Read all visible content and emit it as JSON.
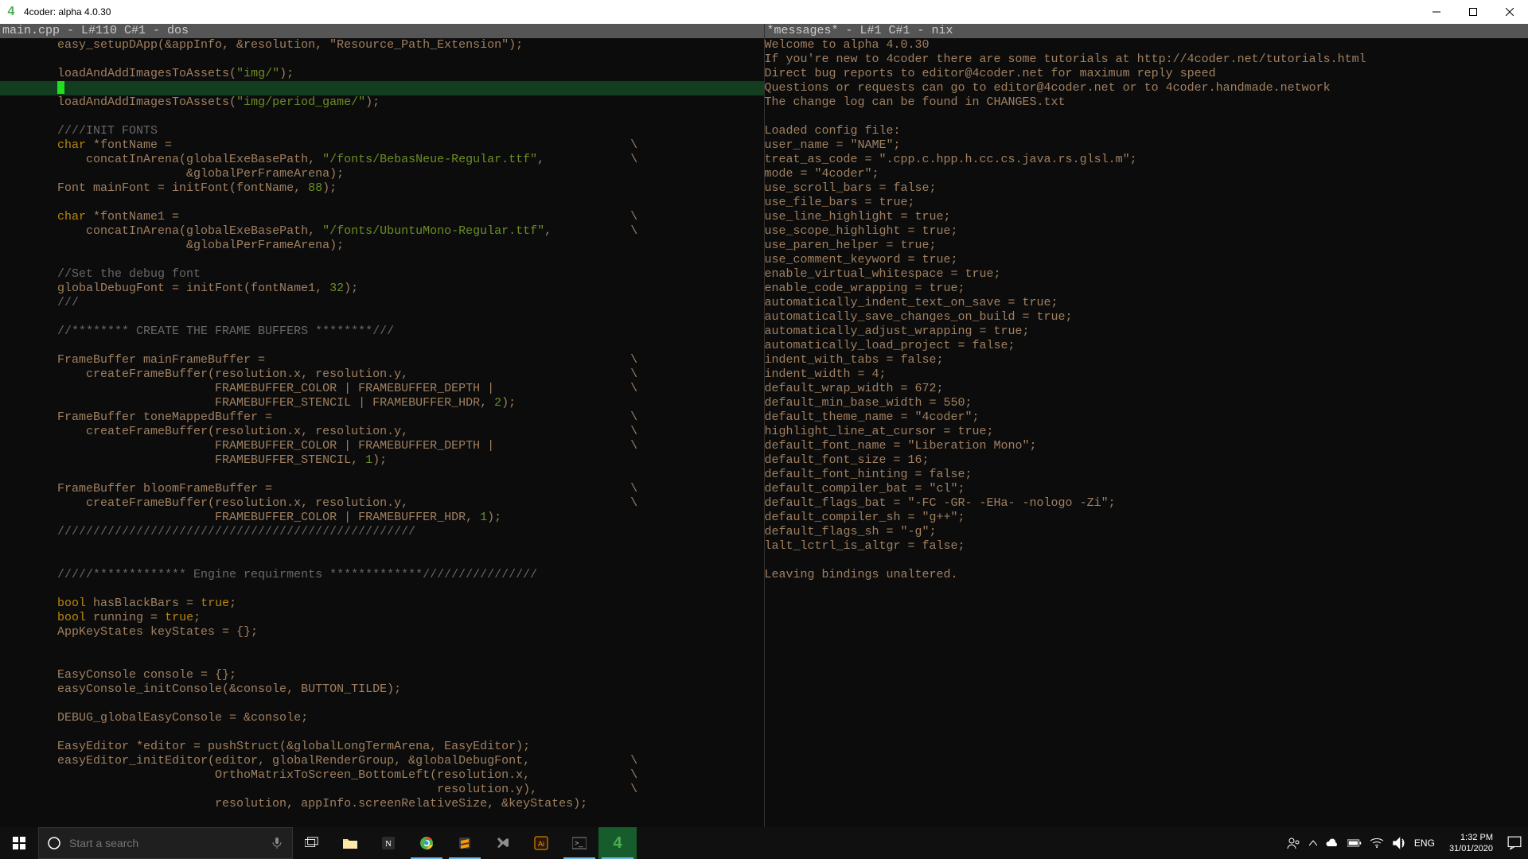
{
  "window": {
    "title": "4coder: alpha 4.0.30",
    "app_icon_char": "4"
  },
  "left_pane": {
    "header": "main.cpp - L#110 C#1 - dos",
    "lines": [
      {
        "indent": 8,
        "segs": [
          [
            "default",
            "easy_setupDApp(&appInfo, &resolution, \"Resource_Path_Extension\");"
          ]
        ]
      },
      {
        "indent": 0,
        "segs": []
      },
      {
        "indent": 8,
        "segs": [
          [
            "default",
            "loadAndAddImagesToAssets("
          ],
          [
            "str",
            "\"img/\""
          ],
          [
            "default",
            ");"
          ]
        ]
      },
      {
        "cursor": true,
        "indent": 8,
        "segs": []
      },
      {
        "indent": 8,
        "segs": [
          [
            "default",
            "loadAndAddImagesToAssets("
          ],
          [
            "str",
            "\"img/period_game/\""
          ],
          [
            "default",
            ");"
          ]
        ]
      },
      {
        "indent": 0,
        "segs": []
      },
      {
        "indent": 8,
        "segs": [
          [
            "comment",
            "////INIT FONTS"
          ]
        ]
      },
      {
        "indent": 8,
        "segs": [
          [
            "kw",
            "char"
          ],
          [
            "default",
            " *fontName ="
          ]
        ],
        "cont": true
      },
      {
        "indent": 12,
        "segs": [
          [
            "default",
            "concatInArena(globalExeBasePath, "
          ],
          [
            "str",
            "\"/fonts/BebasNeue-Regular.ttf\""
          ],
          [
            "default",
            ","
          ]
        ],
        "cont": true
      },
      {
        "indent": 26,
        "segs": [
          [
            "default",
            "&globalPerFrameArena);"
          ]
        ]
      },
      {
        "indent": 8,
        "segs": [
          [
            "default",
            "Font mainFont = initFont(fontName, "
          ],
          [
            "num",
            "88"
          ],
          [
            "default",
            ");"
          ]
        ]
      },
      {
        "indent": 0,
        "segs": []
      },
      {
        "indent": 8,
        "segs": [
          [
            "kw",
            "char"
          ],
          [
            "default",
            " *fontName1 ="
          ]
        ],
        "cont": true
      },
      {
        "indent": 12,
        "segs": [
          [
            "default",
            "concatInArena(globalExeBasePath, "
          ],
          [
            "str",
            "\"/fonts/UbuntuMono-Regular.ttf\""
          ],
          [
            "default",
            ","
          ]
        ],
        "cont": true
      },
      {
        "indent": 26,
        "segs": [
          [
            "default",
            "&globalPerFrameArena);"
          ]
        ]
      },
      {
        "indent": 0,
        "segs": []
      },
      {
        "indent": 8,
        "segs": [
          [
            "comment",
            "//Set the debug font"
          ]
        ]
      },
      {
        "indent": 8,
        "segs": [
          [
            "default",
            "globalDebugFont = initFont(fontName1, "
          ],
          [
            "num",
            "32"
          ],
          [
            "default",
            ");"
          ]
        ]
      },
      {
        "indent": 8,
        "segs": [
          [
            "comment",
            "///"
          ]
        ]
      },
      {
        "indent": 0,
        "segs": []
      },
      {
        "indent": 8,
        "segs": [
          [
            "comment",
            "//******** CREATE THE FRAME BUFFERS ********///"
          ]
        ]
      },
      {
        "indent": 0,
        "segs": []
      },
      {
        "indent": 8,
        "segs": [
          [
            "default",
            "FrameBuffer mainFrameBuffer ="
          ]
        ],
        "cont": true
      },
      {
        "indent": 12,
        "segs": [
          [
            "default",
            "createFrameBuffer(resolution.x, resolution.y,"
          ]
        ],
        "cont": true
      },
      {
        "indent": 30,
        "segs": [
          [
            "default",
            "FRAMEBUFFER_COLOR | FRAMEBUFFER_DEPTH |"
          ]
        ],
        "cont": true
      },
      {
        "indent": 30,
        "segs": [
          [
            "default",
            "FRAMEBUFFER_STENCIL | FRAMEBUFFER_HDR, "
          ],
          [
            "num",
            "2"
          ],
          [
            "default",
            ");"
          ]
        ]
      },
      {
        "indent": 8,
        "segs": [
          [
            "default",
            "FrameBuffer toneMappedBuffer ="
          ]
        ],
        "cont": true
      },
      {
        "indent": 12,
        "segs": [
          [
            "default",
            "createFrameBuffer(resolution.x, resolution.y,"
          ]
        ],
        "cont": true
      },
      {
        "indent": 30,
        "segs": [
          [
            "default",
            "FRAMEBUFFER_COLOR | FRAMEBUFFER_DEPTH |"
          ]
        ],
        "cont": true
      },
      {
        "indent": 30,
        "segs": [
          [
            "default",
            "FRAMEBUFFER_STENCIL, "
          ],
          [
            "num",
            "1"
          ],
          [
            "default",
            ");"
          ]
        ]
      },
      {
        "indent": 0,
        "segs": []
      },
      {
        "indent": 8,
        "segs": [
          [
            "default",
            "FrameBuffer bloomFrameBuffer ="
          ]
        ],
        "cont": true
      },
      {
        "indent": 12,
        "segs": [
          [
            "default",
            "createFrameBuffer(resolution.x, resolution.y,"
          ]
        ],
        "cont": true
      },
      {
        "indent": 30,
        "segs": [
          [
            "default",
            "FRAMEBUFFER_COLOR | FRAMEBUFFER_HDR, "
          ],
          [
            "num",
            "1"
          ],
          [
            "default",
            ");"
          ]
        ]
      },
      {
        "indent": 8,
        "segs": [
          [
            "comment",
            "//////////////////////////////////////////////////"
          ]
        ]
      },
      {
        "indent": 0,
        "segs": []
      },
      {
        "indent": 0,
        "segs": []
      },
      {
        "indent": 8,
        "segs": [
          [
            "comment",
            "/////************* Engine requirments *************////////////////"
          ]
        ]
      },
      {
        "indent": 0,
        "segs": []
      },
      {
        "indent": 8,
        "segs": [
          [
            "kw",
            "bool"
          ],
          [
            "default",
            " hasBlackBars = "
          ],
          [
            "kw",
            "true"
          ],
          [
            "default",
            ";"
          ]
        ]
      },
      {
        "indent": 8,
        "segs": [
          [
            "kw",
            "bool"
          ],
          [
            "default",
            " running = "
          ],
          [
            "kw",
            "true"
          ],
          [
            "default",
            ";"
          ]
        ]
      },
      {
        "indent": 8,
        "segs": [
          [
            "default",
            "AppKeyStates keyStates = {};"
          ]
        ]
      },
      {
        "indent": 0,
        "segs": []
      },
      {
        "indent": 0,
        "segs": []
      },
      {
        "indent": 8,
        "segs": [
          [
            "default",
            "EasyConsole console = {};"
          ]
        ]
      },
      {
        "indent": 8,
        "segs": [
          [
            "default",
            "easyConsole_initConsole(&console, BUTTON_TILDE);"
          ]
        ]
      },
      {
        "indent": 0,
        "segs": []
      },
      {
        "indent": 8,
        "segs": [
          [
            "default",
            "DEBUG_globalEasyConsole = &console;"
          ]
        ]
      },
      {
        "indent": 0,
        "segs": []
      },
      {
        "indent": 8,
        "segs": [
          [
            "default",
            "EasyEditor *editor = pushStruct(&globalLongTermArena, EasyEditor);"
          ]
        ]
      },
      {
        "indent": 8,
        "segs": [
          [
            "default",
            "easyEditor_initEditor(editor, globalRenderGroup, &globalDebugFont,"
          ]
        ],
        "cont": true
      },
      {
        "indent": 30,
        "segs": [
          [
            "default",
            "OrthoMatrixToScreen_BottomLeft(resolution.x,"
          ]
        ],
        "cont": true
      },
      {
        "indent": 61,
        "segs": [
          [
            "default",
            "resolution.y),"
          ]
        ],
        "cont": true
      },
      {
        "indent": 30,
        "segs": [
          [
            "default",
            "resolution, appInfo.screenRelativeSize, &keyStates);"
          ]
        ]
      }
    ]
  },
  "right_pane": {
    "header": "*messages* - L#1 C#1 - nix",
    "lines": [
      "Welcome to alpha 4.0.30",
      "If you're new to 4coder there are some tutorials at http://4coder.net/tutorials.html",
      "Direct bug reports to editor@4coder.net for maximum reply speed",
      "Questions or requests can go to editor@4coder.net or to 4coder.handmade.network",
      "The change log can be found in CHANGES.txt",
      "",
      "Loaded config file:",
      "user_name = \"NAME\";",
      "treat_as_code = \".cpp.c.hpp.h.cc.cs.java.rs.glsl.m\";",
      "mode = \"4coder\";",
      "use_scroll_bars = false;",
      "use_file_bars = true;",
      "use_line_highlight = true;",
      "use_scope_highlight = true;",
      "use_paren_helper = true;",
      "use_comment_keyword = true;",
      "enable_virtual_whitespace = true;",
      "enable_code_wrapping = true;",
      "automatically_indent_text_on_save = true;",
      "automatically_save_changes_on_build = true;",
      "automatically_adjust_wrapping = true;",
      "automatically_load_project = false;",
      "indent_with_tabs = false;",
      "indent_width = 4;",
      "default_wrap_width = 672;",
      "default_min_base_width = 550;",
      "default_theme_name = \"4coder\";",
      "highlight_line_at_cursor = true;",
      "default_font_name = \"Liberation Mono\";",
      "default_font_size = 16;",
      "default_font_hinting = false;",
      "default_compiler_bat = \"cl\";",
      "default_flags_bat = \"-FC -GR- -EHa- -nologo -Zi\";",
      "default_compiler_sh = \"g++\";",
      "default_flags_sh = \"-g\";",
      "lalt_lctrl_is_altgr = false;",
      "",
      "Leaving bindings unaltered."
    ]
  },
  "taskbar": {
    "search_placeholder": "Start a search",
    "lang": "ENG",
    "time": "1:32 PM",
    "date": "31/01/2020"
  }
}
